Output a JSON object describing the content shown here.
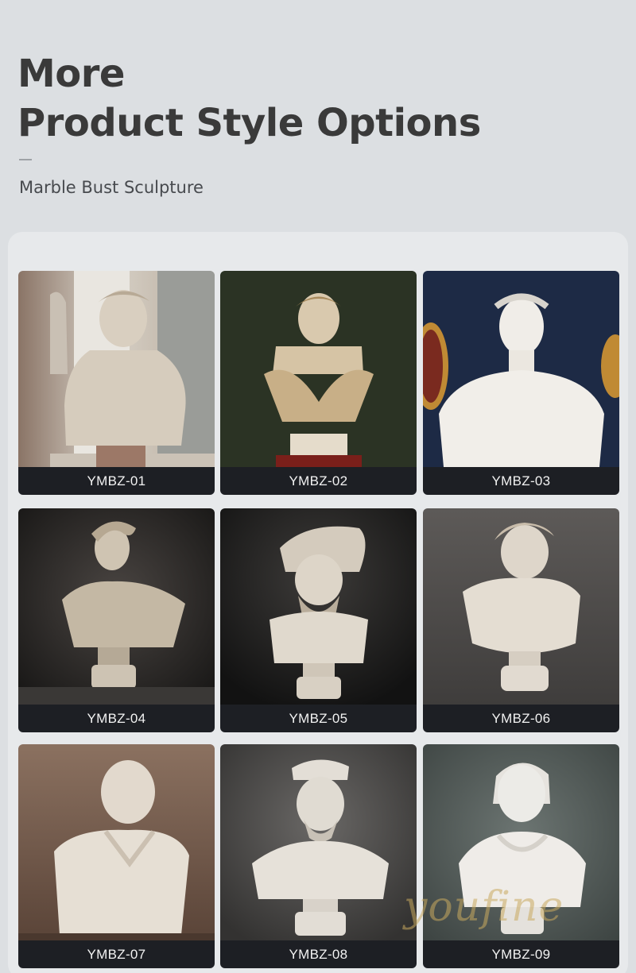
{
  "header": {
    "title_line1": "More",
    "title_line2": "Product Style Options",
    "subtitle": "Marble Bust Sculpture"
  },
  "products": [
    {
      "code": "YMBZ-01"
    },
    {
      "code": "YMBZ-02"
    },
    {
      "code": "YMBZ-03"
    },
    {
      "code": "YMBZ-04"
    },
    {
      "code": "YMBZ-05"
    },
    {
      "code": "YMBZ-06"
    },
    {
      "code": "YMBZ-07"
    },
    {
      "code": "YMBZ-08"
    },
    {
      "code": "YMBZ-09"
    }
  ],
  "watermark": "youfine",
  "colors": {
    "page_background": "#dcdfe2",
    "panel_background": "#e7e9eb",
    "caption_bar": "#1d1f24",
    "caption_text": "#f2f2f2",
    "title_text": "#3a3a3a"
  }
}
